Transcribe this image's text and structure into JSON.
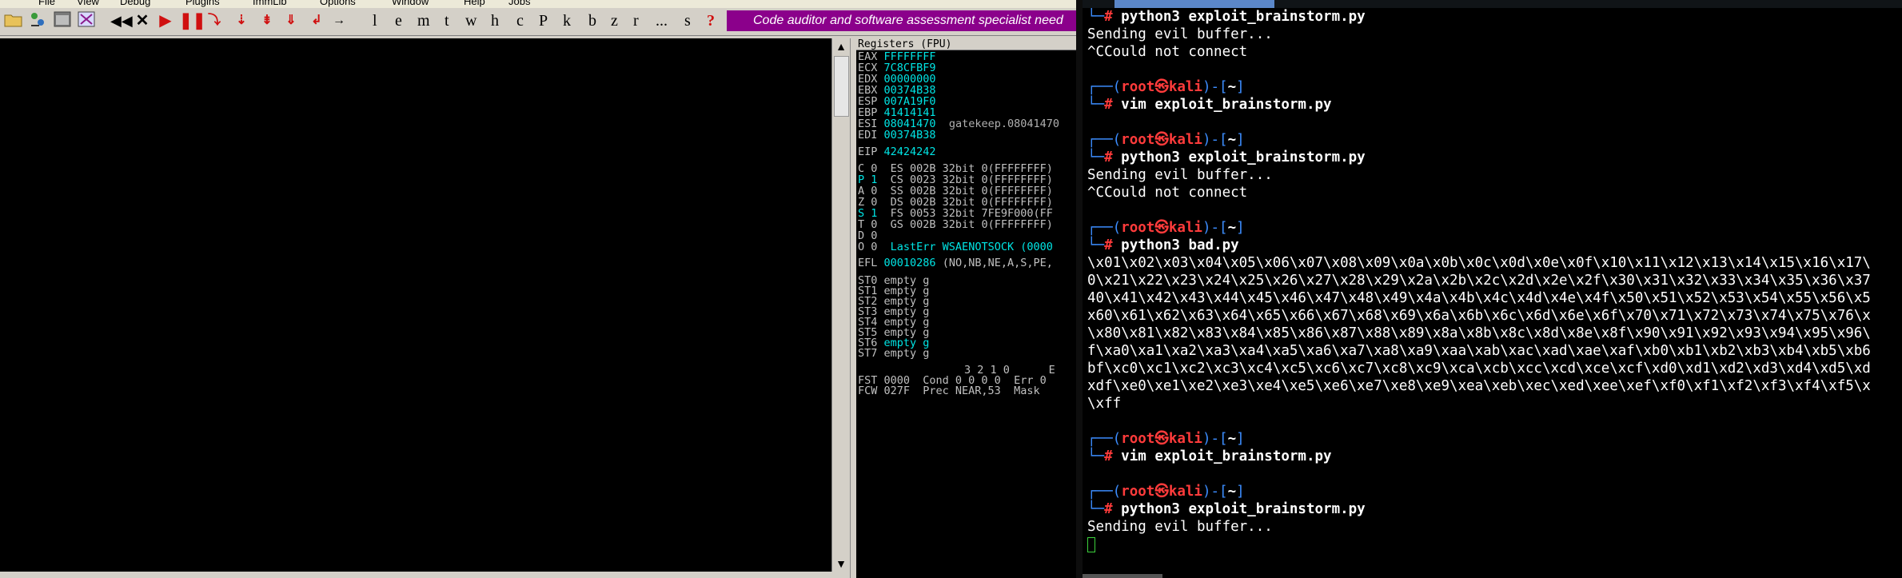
{
  "debugger": {
    "menu": [
      "File",
      "View",
      "Debug",
      "Plugins",
      "ImmLib",
      "Options",
      "Window",
      "Help",
      "Jobs"
    ],
    "toolbar_letters": [
      "l",
      "e",
      "m",
      "t",
      "w",
      "h",
      "c",
      "P",
      "k",
      "b",
      "z",
      "r",
      "...",
      "s",
      "?"
    ],
    "banner": "Code auditor and software assessment specialist need",
    "registers_title": "Registers (FPU)",
    "registers": [
      {
        "name": "EAX",
        "value": "FFFFFFFF",
        "comment": ""
      },
      {
        "name": "ECX",
        "value": "7C8CFBF9",
        "comment": ""
      },
      {
        "name": "EDX",
        "value": "00000000",
        "comment": ""
      },
      {
        "name": "EBX",
        "value": "00374B38",
        "comment": ""
      },
      {
        "name": "ESP",
        "value": "007A19F0",
        "comment": ""
      },
      {
        "name": "EBP",
        "value": "41414141",
        "comment": ""
      },
      {
        "name": "ESI",
        "value": "08041470",
        "comment": "gatekeep.08041470"
      },
      {
        "name": "EDI",
        "value": "00374B38",
        "comment": ""
      }
    ],
    "eip": {
      "name": "EIP",
      "value": "42424242"
    },
    "flags": [
      {
        "flag": "C 0",
        "seg": "ES 002B 32bit 0(FFFFFFFF)"
      },
      {
        "flag": "P 1",
        "seg": "CS 0023 32bit 0(FFFFFFFF)"
      },
      {
        "flag": "A 0",
        "seg": "SS 002B 32bit 0(FFFFFFFF)"
      },
      {
        "flag": "Z 0",
        "seg": "DS 002B 32bit 0(FFFFFFFF)"
      },
      {
        "flag": "S 1",
        "seg": "FS 0053 32bit 7FE9F000(FF"
      },
      {
        "flag": "T 0",
        "seg": "GS 002B 32bit 0(FFFFFFFF)"
      },
      {
        "flag": "D 0",
        "seg": ""
      },
      {
        "flag": "O 0",
        "seg": "LastErr WSAENOTSOCK (0000"
      }
    ],
    "efl": {
      "label": "EFL",
      "value": "00010286",
      "text": "(NO,NB,NE,A,S,PE,"
    },
    "fpu": [
      {
        "name": "ST0",
        "value": "empty g"
      },
      {
        "name": "ST1",
        "value": "empty g"
      },
      {
        "name": "ST2",
        "value": "empty g"
      },
      {
        "name": "ST3",
        "value": "empty g"
      },
      {
        "name": "ST4",
        "value": "empty g"
      },
      {
        "name": "ST5",
        "value": "empty g"
      },
      {
        "name": "ST6",
        "value": "empty g"
      },
      {
        "name": "ST7",
        "value": "empty g"
      }
    ],
    "fpu_bits_header": "3 2 1 0      E",
    "fst": "FST 0000  Cond 0 0 0 0  Err 0",
    "fcw": "FCW 027F  Prec NEAR,53  Mask"
  },
  "terminal": {
    "prompt": {
      "root": "root",
      "at": "㉿",
      "host": "kali",
      "dir": "~"
    },
    "blocks": [
      {
        "type": "cmd",
        "text": "python3 exploit_brainstorm.py",
        "prompt": false
      },
      {
        "type": "out",
        "text": "Sending evil buffer..."
      },
      {
        "type": "out",
        "text": "^CCould not connect"
      },
      {
        "type": "cmd",
        "text": "vim exploit_brainstorm.py",
        "prompt": true
      },
      {
        "type": "cmd",
        "text": "python3 exploit_brainstorm.py",
        "prompt": true
      },
      {
        "type": "out",
        "text": "Sending evil buffer..."
      },
      {
        "type": "out",
        "text": "^CCould not connect"
      },
      {
        "type": "cmd",
        "text": "python3 bad.py",
        "prompt": true
      },
      {
        "type": "out",
        "text": "\\x01\\x02\\x03\\x04\\x05\\x06\\x07\\x08\\x09\\x0a\\x0b\\x0c\\x0d\\x0e\\x0f\\x10\\x11\\x12\\x13\\x14\\x15\\x16\\x17\\"
      },
      {
        "type": "out",
        "text": "0\\x21\\x22\\x23\\x24\\x25\\x26\\x27\\x28\\x29\\x2a\\x2b\\x2c\\x2d\\x2e\\x2f\\x30\\x31\\x32\\x33\\x34\\x35\\x36\\x37"
      },
      {
        "type": "out",
        "text": "40\\x41\\x42\\x43\\x44\\x45\\x46\\x47\\x48\\x49\\x4a\\x4b\\x4c\\x4d\\x4e\\x4f\\x50\\x51\\x52\\x53\\x54\\x55\\x56\\x5"
      },
      {
        "type": "out",
        "text": "x60\\x61\\x62\\x63\\x64\\x65\\x66\\x67\\x68\\x69\\x6a\\x6b\\x6c\\x6d\\x6e\\x6f\\x70\\x71\\x72\\x73\\x74\\x75\\x76\\x"
      },
      {
        "type": "out",
        "text": "\\x80\\x81\\x82\\x83\\x84\\x85\\x86\\x87\\x88\\x89\\x8a\\x8b\\x8c\\x8d\\x8e\\x8f\\x90\\x91\\x92\\x93\\x94\\x95\\x96\\"
      },
      {
        "type": "out",
        "text": "f\\xa0\\xa1\\xa2\\xa3\\xa4\\xa5\\xa6\\xa7\\xa8\\xa9\\xaa\\xab\\xac\\xad\\xae\\xaf\\xb0\\xb1\\xb2\\xb3\\xb4\\xb5\\xb6"
      },
      {
        "type": "out",
        "text": "bf\\xc0\\xc1\\xc2\\xc3\\xc4\\xc5\\xc6\\xc7\\xc8\\xc9\\xca\\xcb\\xcc\\xcd\\xce\\xcf\\xd0\\xd1\\xd2\\xd3\\xd4\\xd5\\xd"
      },
      {
        "type": "out",
        "text": "xdf\\xe0\\xe1\\xe2\\xe3\\xe4\\xe5\\xe6\\xe7\\xe8\\xe9\\xea\\xeb\\xec\\xed\\xee\\xef\\xf0\\xf1\\xf2\\xf3\\xf4\\xf5\\x"
      },
      {
        "type": "out",
        "text": "\\xff"
      },
      {
        "type": "cmd",
        "text": "vim exploit_brainstorm.py",
        "prompt": true
      },
      {
        "type": "cmd",
        "text": "python3 exploit_brainstorm.py",
        "prompt": true
      },
      {
        "type": "out",
        "text": "Sending evil buffer..."
      }
    ]
  }
}
